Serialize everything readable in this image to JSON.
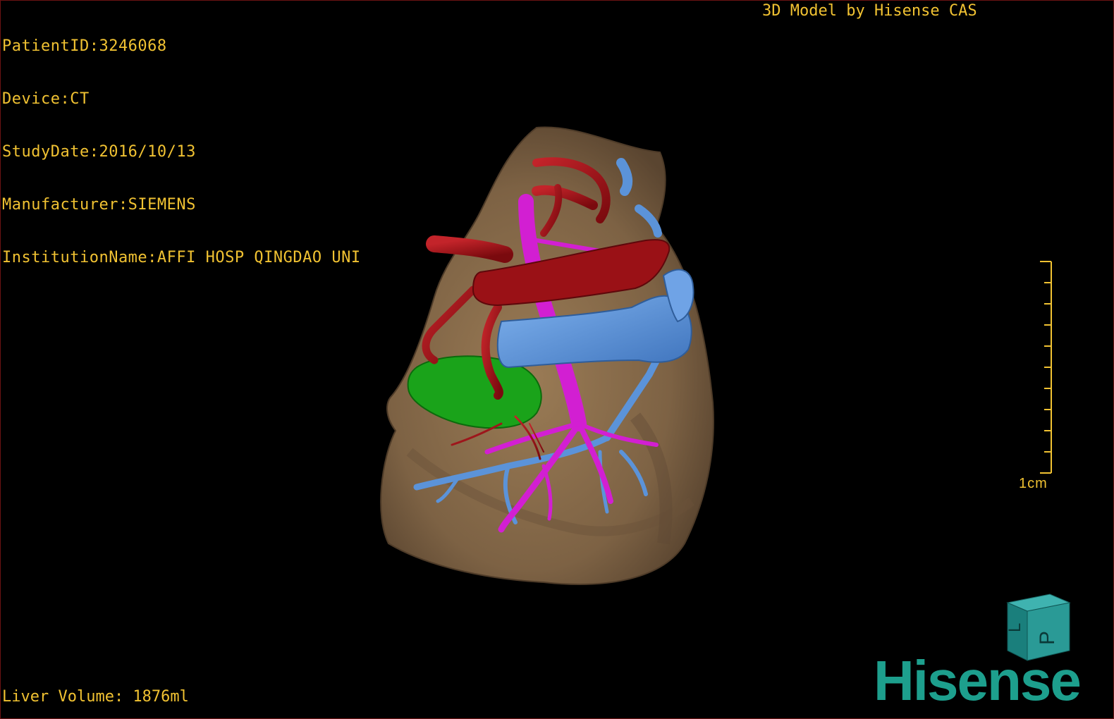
{
  "overlay": {
    "patient_id": "PatientID:3246068",
    "device": "Device:CT",
    "study_date": "StudyDate:2016/10/13",
    "manufacturer": "Manufacturer:SIEMENS",
    "institution": "InstitutionName:AFFI HOSP QINGDAO UNI",
    "credit": "3D Model by Hisense CAS",
    "liver_volume": "Liver Volume: 1876ml"
  },
  "scale": {
    "label": "1cm"
  },
  "orientation_cube": {
    "face_top": "L",
    "face_front": "P"
  },
  "brand": {
    "logo_text": "Hisense"
  },
  "colors": {
    "overlay_text": "#f1c232",
    "liver": "#8a6e4b",
    "artery": "#a8141a",
    "portal_vein": "#d21fd2",
    "hepatic_vein": "#5b93d9",
    "gallbladder": "#1aa31a",
    "brand": "#1d9f8d"
  }
}
